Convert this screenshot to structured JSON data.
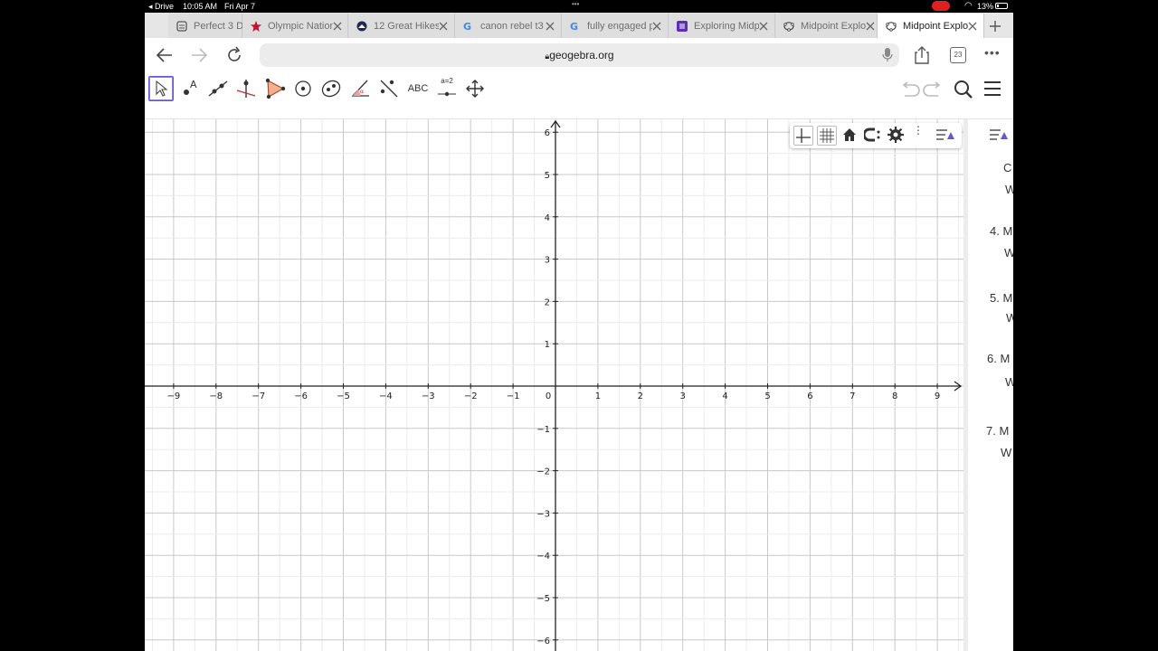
{
  "status_bar": {
    "back_app": "Drive",
    "time": "10:05 AM",
    "date": "Fri Apr 7",
    "battery": "13%"
  },
  "tabs": [
    {
      "label": "Perfect 3 D",
      "icon": "page-icon",
      "active": false
    },
    {
      "label": "Olympic Nation",
      "icon": "star-icon",
      "active": false
    },
    {
      "label": "12 Great Hikes",
      "icon": "circle-logo-icon",
      "active": false
    },
    {
      "label": "canon rebel t3",
      "icon": "google-icon",
      "active": false
    },
    {
      "label": "fully engaged p",
      "icon": "google-icon",
      "active": false
    },
    {
      "label": "Exploring Midp",
      "icon": "form-icon",
      "active": false
    },
    {
      "label": "Midpoint Explo",
      "icon": "geogebra-icon",
      "active": false
    },
    {
      "label": "Midpoint Explo",
      "icon": "geogebra-icon",
      "active": true
    }
  ],
  "address_bar": {
    "url": "geogebra.org",
    "tab_count": "23"
  },
  "toolbar": {
    "text_tool_label": "ABC",
    "slider_tool_label": "a=2"
  },
  "graph": {
    "x_ticks": [
      "−9",
      "−8",
      "−7",
      "−6",
      "−5",
      "−4",
      "−3",
      "−2",
      "−1",
      "0",
      "1",
      "2",
      "3",
      "4",
      "5",
      "6",
      "7",
      "8",
      "9"
    ],
    "y_ticks_pos": [
      "1",
      "2",
      "3",
      "4",
      "5",
      "6"
    ],
    "y_ticks_neg": [
      "−1",
      "−2",
      "−3",
      "−4",
      "−5",
      "−6"
    ],
    "x_range": [
      -9.7,
      9.7
    ],
    "y_range": [
      -6.3,
      6.3
    ],
    "grid": true
  },
  "side_panel": {
    "items": [
      {
        "text": "C",
        "x": 0,
        "y": 0
      },
      {
        "text": "W",
        "x": 0,
        "y": 0
      },
      {
        "text": "4. M",
        "x": 0,
        "y": 0
      },
      {
        "text": "W",
        "x": 0,
        "y": 0
      },
      {
        "text": "5. M",
        "x": 0,
        "y": 0
      },
      {
        "text": "W",
        "x": 0,
        "y": 0
      },
      {
        "text": "6. M",
        "x": 0,
        "y": 0
      },
      {
        "text": "W",
        "x": 0,
        "y": 0
      },
      {
        "text": "7. M",
        "x": 0,
        "y": 0
      },
      {
        "text": "W",
        "x": 0,
        "y": 0
      }
    ]
  }
}
